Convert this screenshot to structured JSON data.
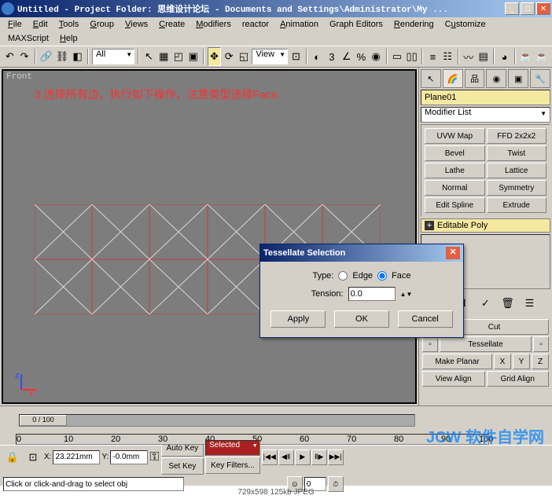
{
  "window": {
    "title": "Untitled   - Project Folder: 思维设计论坛 - Documents and Settings\\Administrator\\My ..."
  },
  "menu": {
    "items": [
      "File",
      "Edit",
      "Tools",
      "Group",
      "Views",
      "Create",
      "Modifiers",
      "reactor",
      "Animation",
      "Graph Editors",
      "Rendering",
      "Customize"
    ],
    "items2": [
      "MAXScript",
      "Help"
    ]
  },
  "toolbar": {
    "dropdown1": "All",
    "dropdown2": "View"
  },
  "viewport": {
    "label": "Front",
    "annotation": "3.选择所有边，执行如下操作，注意类型选择Face."
  },
  "panel": {
    "object_name": "Plane01",
    "modifier_list": "Modifier List",
    "buttons": [
      "UVW Map",
      "FFD 2x2x2",
      "Bevel",
      "Twist",
      "Lathe",
      "Lattice",
      "Normal",
      "Symmetry",
      "Edit Spline",
      "Extrude"
    ],
    "modifier": "Editable Poly",
    "lower": {
      "cut": "Cut",
      "tessellate": "Tessellate",
      "make_planar": "Make Planar",
      "x": "X",
      "y": "Y",
      "z": "Z",
      "view_align": "View Align",
      "grid_align": "Grid Align"
    }
  },
  "dialog": {
    "title": "Tessellate Selection",
    "type_label": "Type:",
    "edge": "Edge",
    "face": "Face",
    "tension_label": "Tension:",
    "tension_value": "0.0",
    "apply": "Apply",
    "ok": "OK",
    "cancel": "Cancel"
  },
  "timeline": {
    "handle": "0 / 100",
    "ticks": [
      "0",
      "10",
      "20",
      "30",
      "40",
      "50",
      "60",
      "70",
      "80",
      "90",
      "100"
    ]
  },
  "status": {
    "x_val": "23.221mm",
    "y_val": "-0.0mm",
    "auto_key": "Auto Key",
    "set_key": "Set Key",
    "selected": "Selected",
    "key_filters": "Key Filters...",
    "frame": "0",
    "prompt": "Click or click-and-drag to select obj"
  },
  "footer": {
    "text": "729x598  125kb  JPEG"
  }
}
